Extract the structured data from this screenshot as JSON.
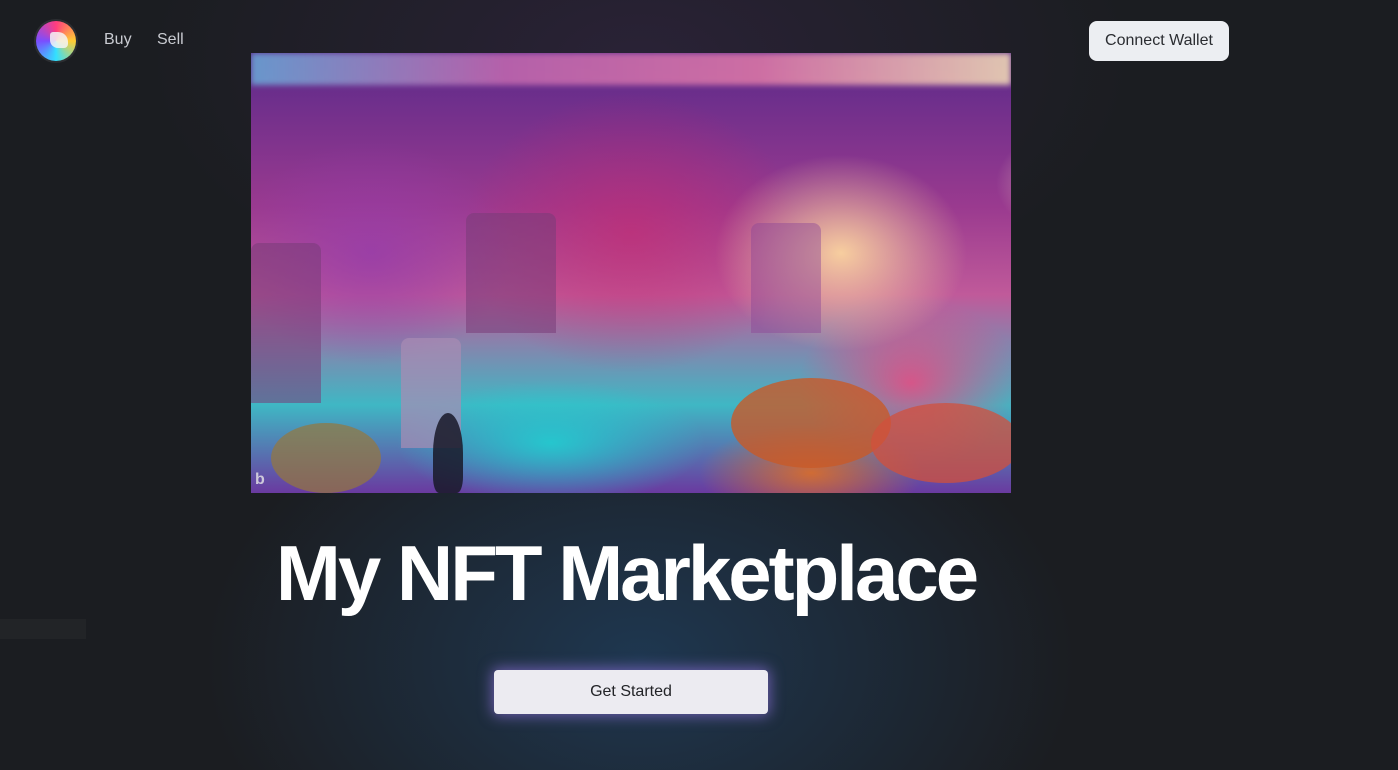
{
  "nav": {
    "logo_icon": "nft-logo-icon",
    "links": [
      "Buy",
      "Sell"
    ],
    "connect_wallet_label": "Connect Wallet"
  },
  "hero": {
    "image_description_icon": "fantasy-castle-artwork",
    "title": "My NFT Marketplace",
    "cta_label": "Get Started"
  },
  "colors": {
    "background": "#1b1d21",
    "button_bg": "#eceef2",
    "title_text": "#ffffff",
    "nav_text": "#c9cbd1"
  }
}
